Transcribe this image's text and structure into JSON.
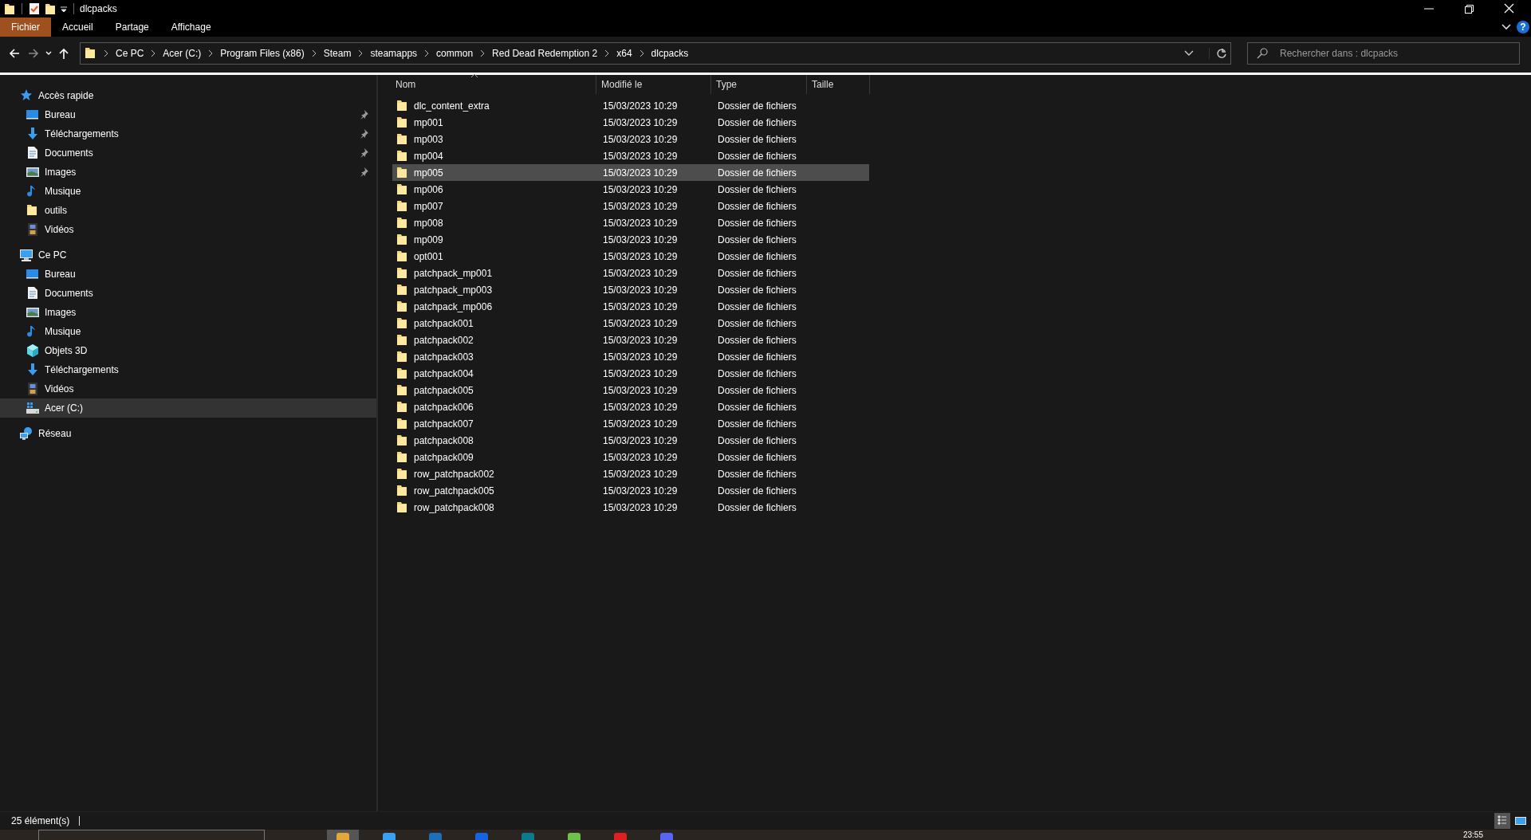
{
  "title_bar": {
    "title": "dlcpacks"
  },
  "ribbon": {
    "tabs": [
      {
        "label": "Fichier",
        "selected": true
      },
      {
        "label": "Accueil",
        "selected": false
      },
      {
        "label": "Partage",
        "selected": false
      },
      {
        "label": "Affichage",
        "selected": false
      }
    ],
    "help": "?"
  },
  "address_bar": {
    "segments": [
      "Ce PC",
      "Acer (C:)",
      "Program Files (x86)",
      "Steam",
      "steamapps",
      "common",
      "Red Dead Redemption 2",
      "x64",
      "dlcpacks"
    ]
  },
  "search": {
    "placeholder": "Rechercher dans : dlcpacks"
  },
  "sidebar": {
    "sections": [
      {
        "label": "Accès rapide",
        "kind": "star",
        "selected": false,
        "children": [
          {
            "label": "Bureau",
            "kind": "desktop",
            "pinned": true,
            "selected": false
          },
          {
            "label": "Téléchargements",
            "kind": "download",
            "pinned": true,
            "selected": false
          },
          {
            "label": "Documents",
            "kind": "document",
            "pinned": true,
            "selected": false
          },
          {
            "label": "Images",
            "kind": "image",
            "pinned": true,
            "selected": false
          },
          {
            "label": "Musique",
            "kind": "music",
            "pinned": false,
            "selected": false
          },
          {
            "label": "outils",
            "kind": "folder",
            "pinned": false,
            "selected": false
          },
          {
            "label": "Vidéos",
            "kind": "video",
            "pinned": false,
            "selected": false
          }
        ]
      },
      {
        "label": "Ce PC",
        "kind": "pc",
        "selected": false,
        "children": [
          {
            "label": "Bureau",
            "kind": "desktop",
            "pinned": false,
            "selected": false
          },
          {
            "label": "Documents",
            "kind": "document",
            "pinned": false,
            "selected": false
          },
          {
            "label": "Images",
            "kind": "image",
            "pinned": false,
            "selected": false
          },
          {
            "label": "Musique",
            "kind": "music",
            "pinned": false,
            "selected": false
          },
          {
            "label": "Objets 3D",
            "kind": "cube",
            "pinned": false,
            "selected": false
          },
          {
            "label": "Téléchargements",
            "kind": "download",
            "pinned": false,
            "selected": false
          },
          {
            "label": "Vidéos",
            "kind": "video",
            "pinned": false,
            "selected": false
          },
          {
            "label": "Acer (C:)",
            "kind": "drive",
            "pinned": false,
            "selected": true
          }
        ]
      },
      {
        "label": "Réseau",
        "kind": "network",
        "selected": false
      }
    ]
  },
  "table": {
    "columns": [
      "Nom",
      "Modifié le",
      "Type",
      "Taille"
    ],
    "rows": [
      {
        "name": "dlc_content_extra",
        "modified": "15/03/2023 10:29",
        "type": "Dossier de fichiers",
        "selected": false
      },
      {
        "name": "mp001",
        "modified": "15/03/2023 10:29",
        "type": "Dossier de fichiers",
        "selected": false
      },
      {
        "name": "mp003",
        "modified": "15/03/2023 10:29",
        "type": "Dossier de fichiers",
        "selected": false
      },
      {
        "name": "mp004",
        "modified": "15/03/2023 10:29",
        "type": "Dossier de fichiers",
        "selected": false
      },
      {
        "name": "mp005",
        "modified": "15/03/2023 10:29",
        "type": "Dossier de fichiers",
        "selected": true
      },
      {
        "name": "mp006",
        "modified": "15/03/2023 10:29",
        "type": "Dossier de fichiers",
        "selected": false
      },
      {
        "name": "mp007",
        "modified": "15/03/2023 10:29",
        "type": "Dossier de fichiers",
        "selected": false
      },
      {
        "name": "mp008",
        "modified": "15/03/2023 10:29",
        "type": "Dossier de fichiers",
        "selected": false
      },
      {
        "name": "mp009",
        "modified": "15/03/2023 10:29",
        "type": "Dossier de fichiers",
        "selected": false
      },
      {
        "name": "opt001",
        "modified": "15/03/2023 10:29",
        "type": "Dossier de fichiers",
        "selected": false
      },
      {
        "name": "patchpack_mp001",
        "modified": "15/03/2023 10:29",
        "type": "Dossier de fichiers",
        "selected": false
      },
      {
        "name": "patchpack_mp003",
        "modified": "15/03/2023 10:29",
        "type": "Dossier de fichiers",
        "selected": false
      },
      {
        "name": "patchpack_mp006",
        "modified": "15/03/2023 10:29",
        "type": "Dossier de fichiers",
        "selected": false
      },
      {
        "name": "patchpack001",
        "modified": "15/03/2023 10:29",
        "type": "Dossier de fichiers",
        "selected": false
      },
      {
        "name": "patchpack002",
        "modified": "15/03/2023 10:29",
        "type": "Dossier de fichiers",
        "selected": false
      },
      {
        "name": "patchpack003",
        "modified": "15/03/2023 10:29",
        "type": "Dossier de fichiers",
        "selected": false
      },
      {
        "name": "patchpack004",
        "modified": "15/03/2023 10:29",
        "type": "Dossier de fichiers",
        "selected": false
      },
      {
        "name": "patchpack005",
        "modified": "15/03/2023 10:29",
        "type": "Dossier de fichiers",
        "selected": false
      },
      {
        "name": "patchpack006",
        "modified": "15/03/2023 10:29",
        "type": "Dossier de fichiers",
        "selected": false
      },
      {
        "name": "patchpack007",
        "modified": "15/03/2023 10:29",
        "type": "Dossier de fichiers",
        "selected": false
      },
      {
        "name": "patchpack008",
        "modified": "15/03/2023 10:29",
        "type": "Dossier de fichiers",
        "selected": false
      },
      {
        "name": "patchpack009",
        "modified": "15/03/2023 10:29",
        "type": "Dossier de fichiers",
        "selected": false
      },
      {
        "name": "row_patchpack002",
        "modified": "15/03/2023 10:29",
        "type": "Dossier de fichiers",
        "selected": false
      },
      {
        "name": "row_patchpack005",
        "modified": "15/03/2023 10:29",
        "type": "Dossier de fichiers",
        "selected": false
      },
      {
        "name": "row_patchpack008",
        "modified": "15/03/2023 10:29",
        "type": "Dossier de fichiers",
        "selected": false
      }
    ]
  },
  "status_bar": {
    "count": "25 élément(s)",
    "views": [
      {
        "kind": "details",
        "selected": true
      },
      {
        "kind": "tiles",
        "selected": false
      }
    ]
  },
  "taskbar": {
    "clock": "23:55"
  }
}
